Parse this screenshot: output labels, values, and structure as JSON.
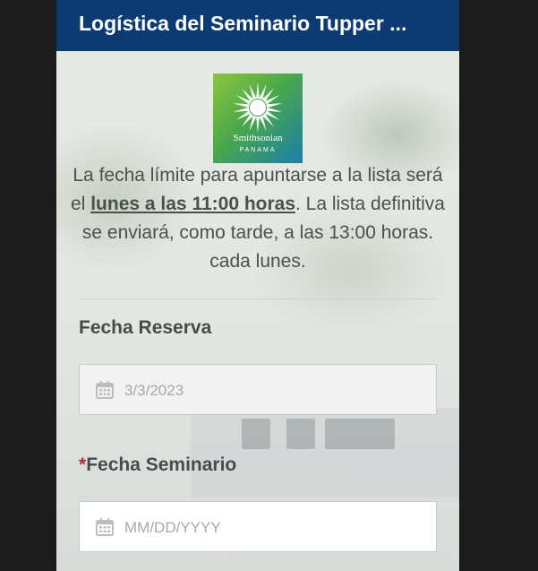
{
  "header": {
    "title": "Logística del Seminario Tupper ..."
  },
  "logo": {
    "name": "Smithsonian",
    "subname": "PANAMA"
  },
  "description": {
    "before": "La fecha límite para apuntarse a la lista será el ",
    "strong": "lunes a las 11:00 horas",
    "after": ". La lista definitiva se enviará, como tarde, a las 13:00 horas. cada lunes."
  },
  "fields": {
    "fecha_reserva": {
      "label": "Fecha Reserva",
      "value": "3/3/2023"
    },
    "fecha_seminario": {
      "required_mark": "*",
      "label": "Fecha Seminario",
      "placeholder": "MM/DD/YYYY",
      "value": ""
    }
  },
  "colors": {
    "header_bg": "#0c3a73",
    "required": "#b03030",
    "text": "#4e4e4e"
  },
  "icons": {
    "date": "calendar-icon",
    "logo": "sun-icon"
  }
}
